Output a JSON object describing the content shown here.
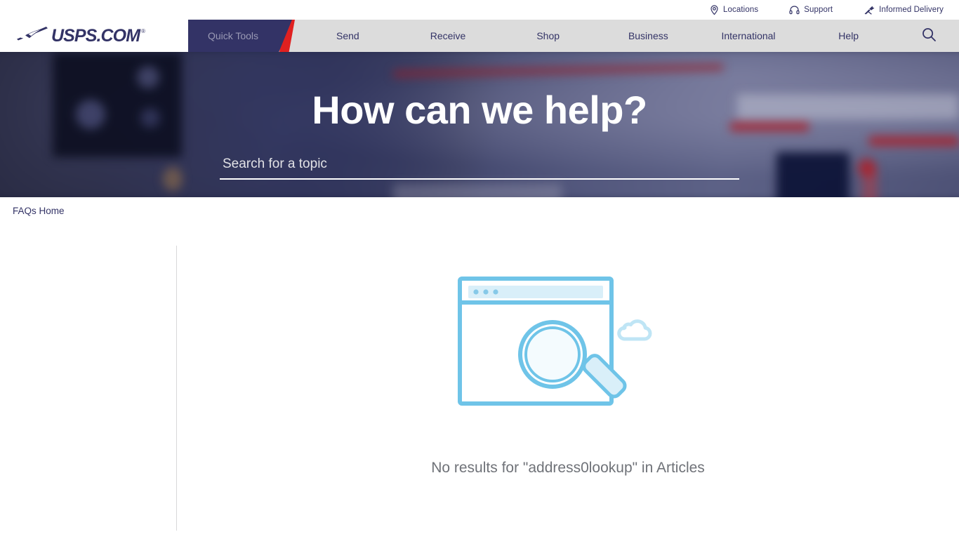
{
  "utility_bar": {
    "items": [
      {
        "label": "Locations",
        "icon": "map-pin-icon"
      },
      {
        "label": "Support",
        "icon": "headset-icon"
      },
      {
        "label": "Informed Delivery",
        "icon": "eagle-icon"
      }
    ]
  },
  "brand": {
    "wordmark": "USPS.COM",
    "registered_mark": "®",
    "logo_icon": "usps-eagle-logo"
  },
  "main_nav": {
    "active_tab": "Quick Tools",
    "links": [
      "Send",
      "Receive",
      "Shop",
      "Business",
      "International",
      "Help"
    ],
    "search_icon": "search-icon"
  },
  "hero": {
    "title": "How can we help?",
    "search_placeholder": "Search for a topic",
    "search_value": ""
  },
  "breadcrumb": {
    "items": [
      "FAQs Home"
    ]
  },
  "results": {
    "illustration_icon": "browser-search-illustration",
    "message": "No results for \"address0lookup\" in Articles",
    "query": "address0lookup",
    "scope": "Articles"
  },
  "colors": {
    "navy": "#333366",
    "red": "#e02020",
    "nav_gray": "#dcdcdc",
    "illustration_blue": "#6fc4e8",
    "message_gray": "#6f7278"
  }
}
